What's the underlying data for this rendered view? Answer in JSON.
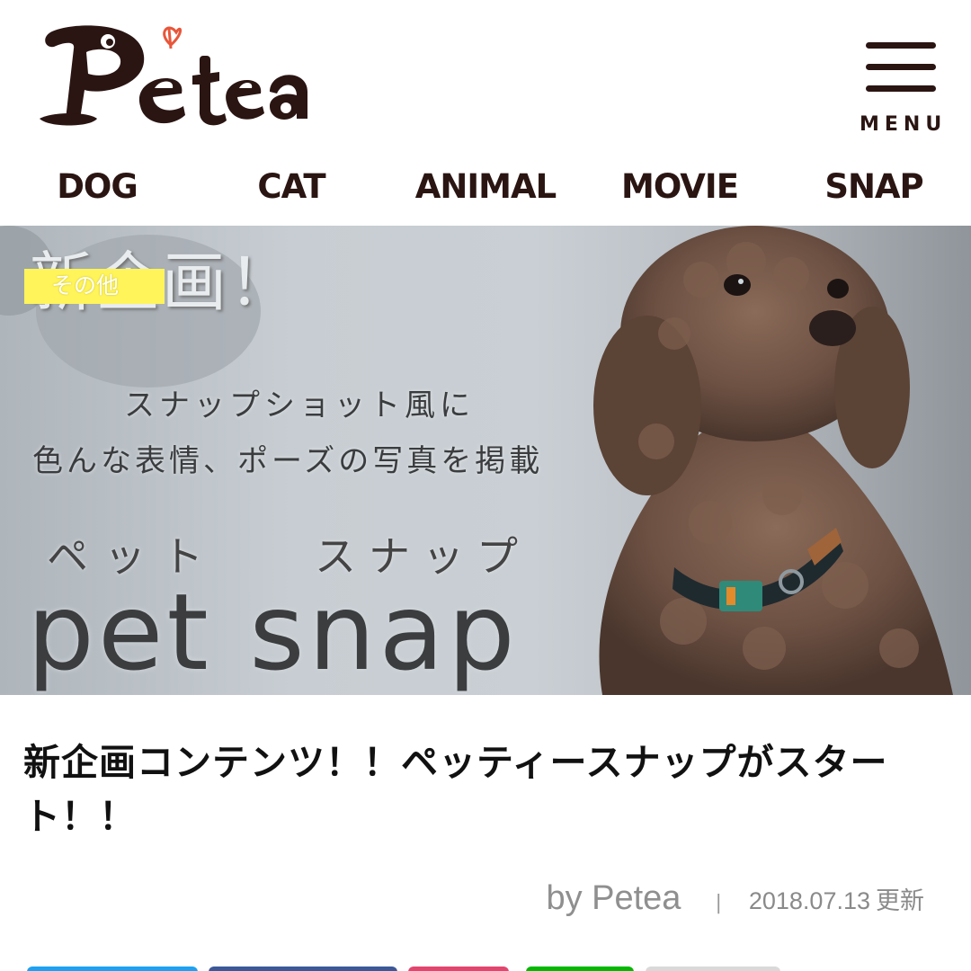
{
  "header": {
    "logo_text": "Petea",
    "menu_label": "MENU"
  },
  "nav": {
    "items": [
      "DOG",
      "CAT",
      "ANIMAL",
      "MOVIE",
      "SNAP"
    ]
  },
  "hero": {
    "category_badge": "その他",
    "headline": "新企画！",
    "line1": "スナップショット風に",
    "line2": "色んな表情、ポーズの写真を掲載",
    "kana_left": "ペット",
    "kana_right": "スナップ",
    "brand": "pet snap"
  },
  "article": {
    "title": "新企画コンテンツ！！ペッティースナップがスタート！！",
    "author": "by Petea",
    "separator": "|",
    "date": "2018.07.13",
    "updated_label": "更新"
  },
  "share": {
    "colors": [
      "#1da1f2",
      "#3b5998",
      "#e2466f",
      "#00b900",
      "#d9d9d9"
    ]
  },
  "colors": {
    "brand_brown": "#2a1512",
    "logo_heart": "#e8563a",
    "badge_yellow": "#fff45a"
  }
}
